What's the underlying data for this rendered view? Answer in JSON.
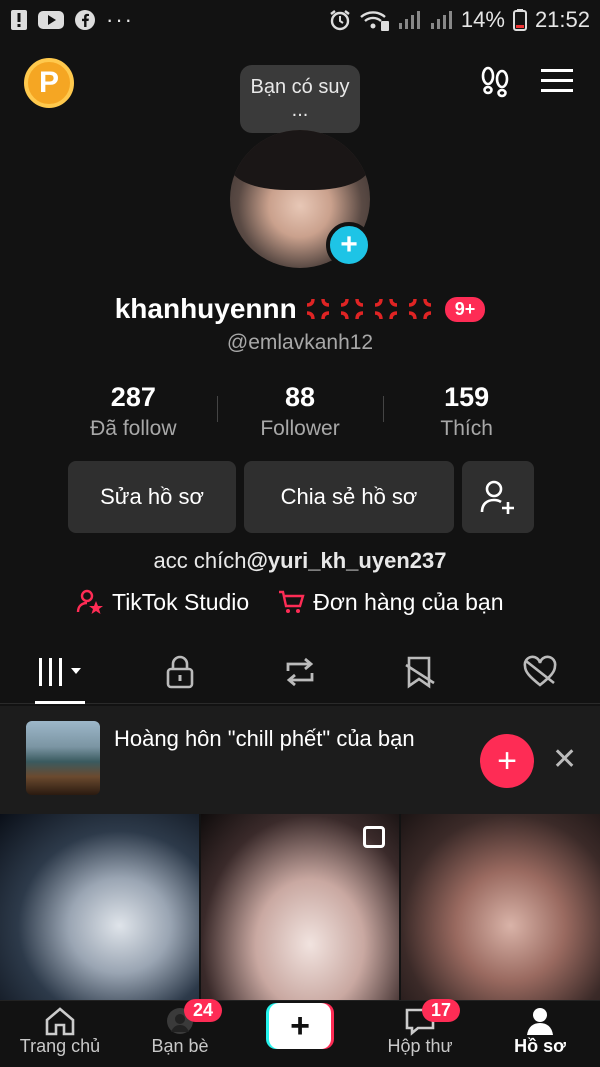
{
  "status_bar": {
    "battery": "14%",
    "time": "21:52",
    "icons": [
      "alert-icon",
      "youtube-icon",
      "facebook-icon",
      "more-dots-icon",
      "alarm-icon",
      "wifi-icon",
      "signal-icon",
      "signal-icon",
      "battery-icon"
    ]
  },
  "header": {
    "coin_label": "P",
    "tooltip": "Bạn có suy ..."
  },
  "profile": {
    "display_name": "khanhuyennn",
    "notification_badge": "9+",
    "username": "@emlavkanh12",
    "stats": [
      {
        "value": "287",
        "label": "Đã follow"
      },
      {
        "value": "88",
        "label": "Follower"
      },
      {
        "value": "159",
        "label": "Thích"
      }
    ],
    "edit_button": "Sửa hồ sơ",
    "share_button": "Chia sẻ hồ sơ",
    "bio_prefix": "acc chích",
    "bio_mention": "@yuri_kh_uyen237",
    "studio_link": "TikTok Studio",
    "orders_link": "Đơn hàng của bạn"
  },
  "tabs": [
    "videos-grid-icon",
    "lock-icon",
    "repost-icon",
    "bookmark-icon",
    "liked-icon"
  ],
  "banner": {
    "text": "Hoàng hôn \"chill phết\" của bạn"
  },
  "bottom_nav": {
    "items": [
      {
        "label": "Trang chủ",
        "icon": "home-icon"
      },
      {
        "label": "Bạn bè",
        "icon": "friends-icon",
        "badge": "24"
      },
      {
        "label": "",
        "icon": "create-icon"
      },
      {
        "label": "Hộp thư",
        "icon": "inbox-icon",
        "badge": "17"
      },
      {
        "label": "Hồ sơ",
        "icon": "profile-icon"
      }
    ]
  },
  "colors": {
    "background": "#121212",
    "accent": "#fe2c55",
    "cyan": "#25f4ee",
    "button_bg": "#2f2f2f"
  }
}
